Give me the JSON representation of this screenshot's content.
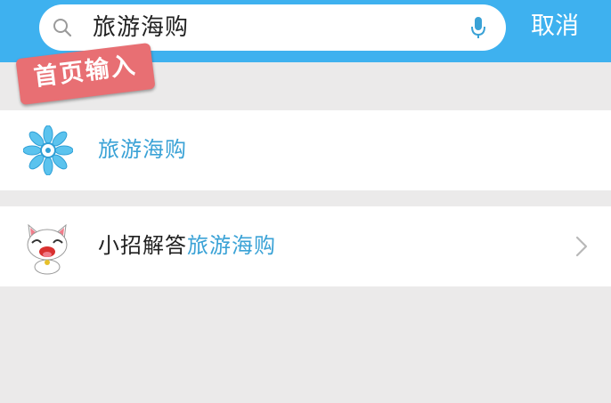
{
  "search": {
    "query": "旅游海购",
    "cancel_label": "取消"
  },
  "stamp": {
    "label": "首页输入"
  },
  "results": {
    "item1": {
      "label": "旅游海购",
      "icon": "blue-flower-icon"
    },
    "item2": {
      "prefix": "小招解答",
      "highlight": "旅游海购",
      "icon": "cat-mascot-icon"
    }
  },
  "colors": {
    "header": "#3eb1ef",
    "highlight": "#3aa2d6",
    "stamp": "#e86f73",
    "background": "#ebeaea"
  }
}
